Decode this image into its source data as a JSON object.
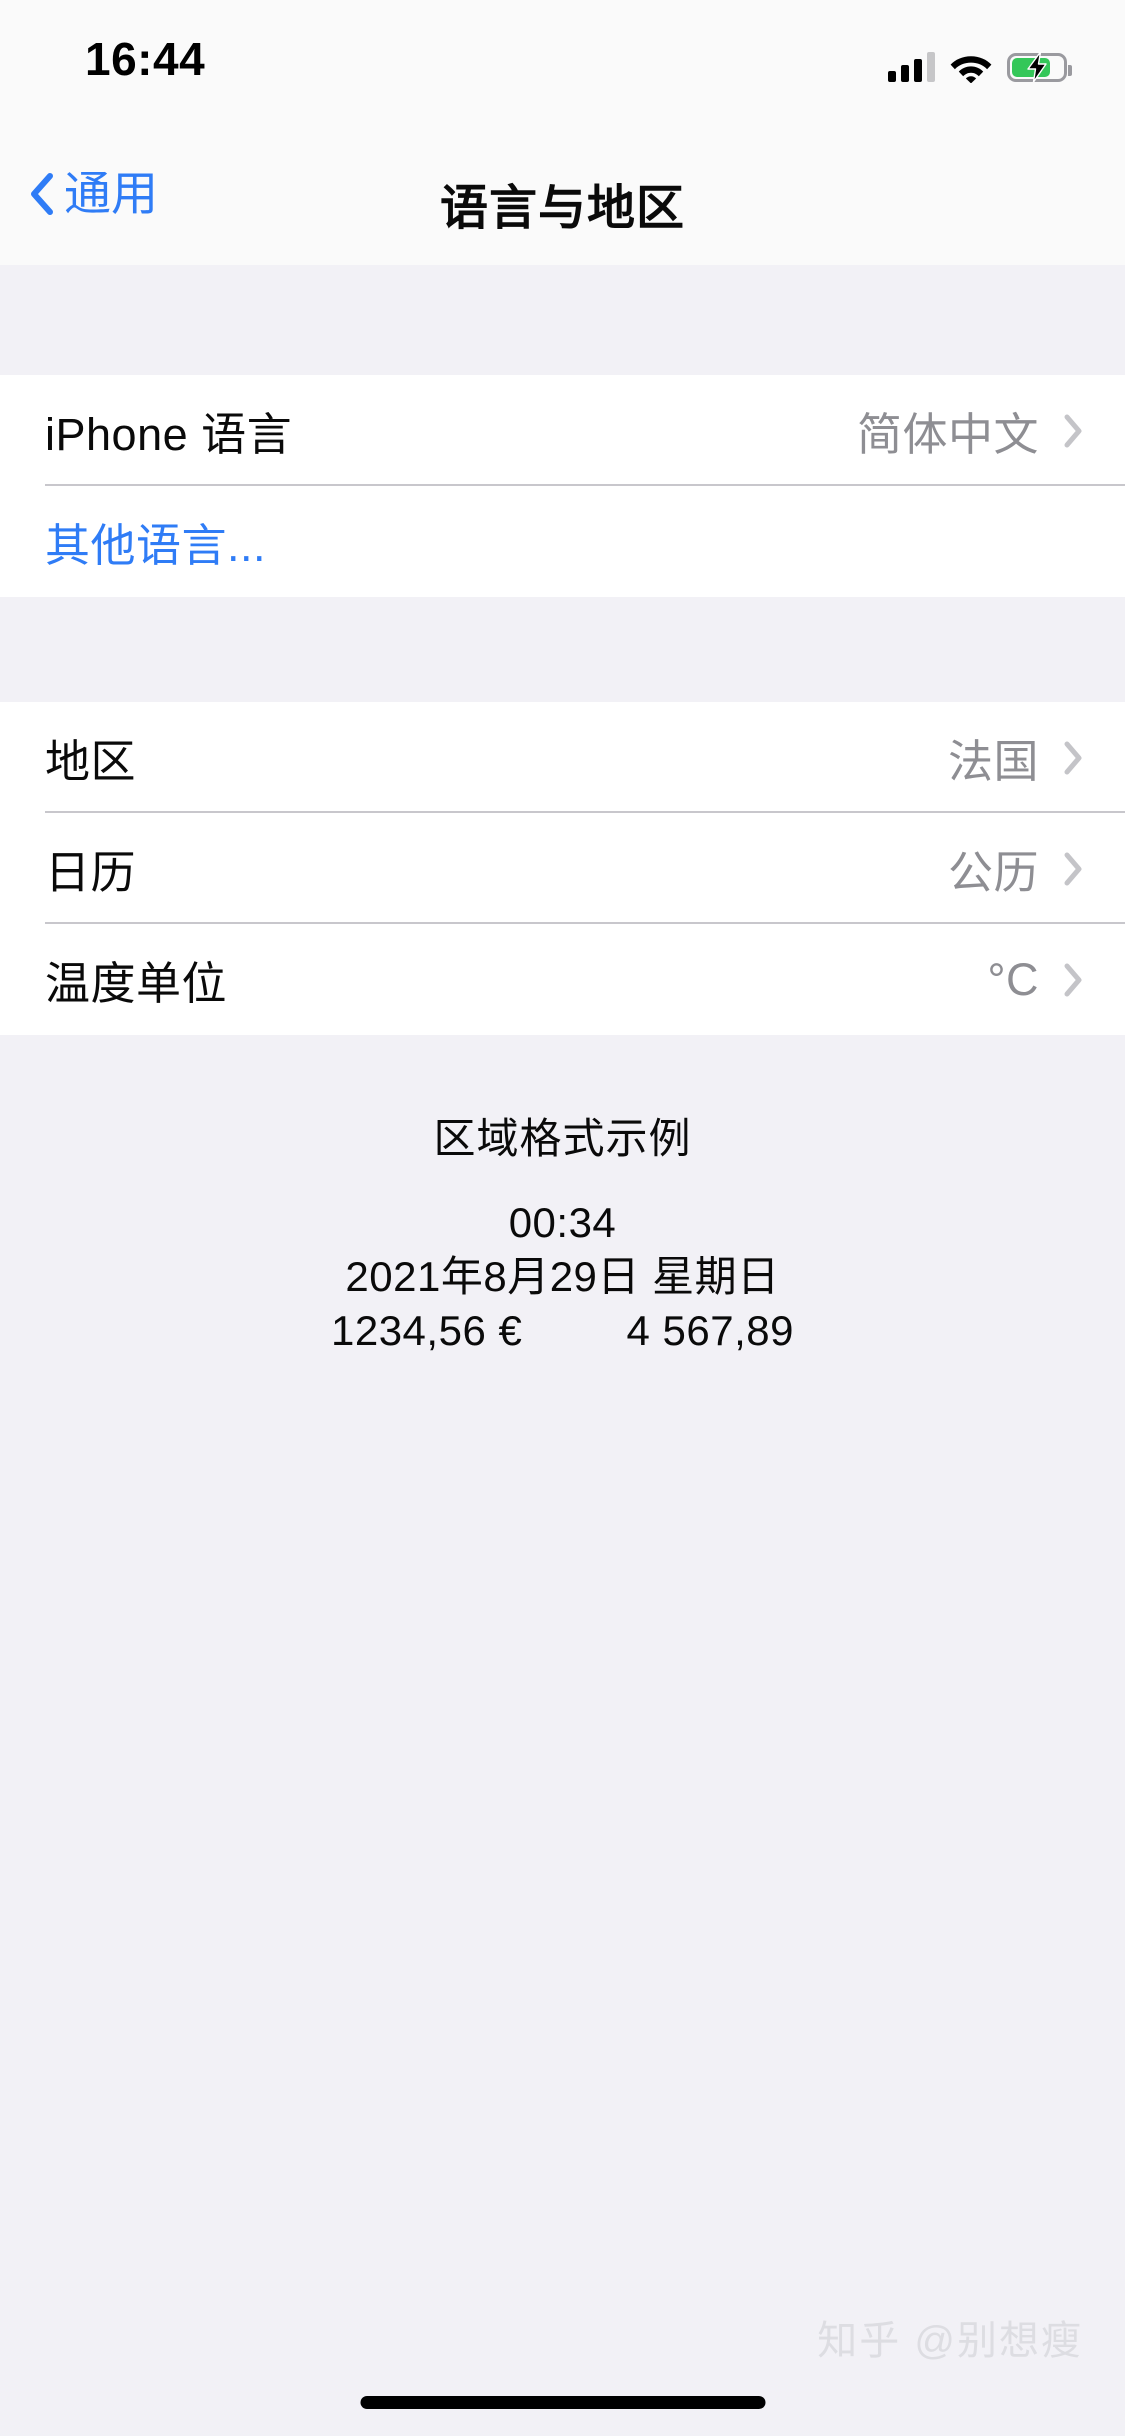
{
  "status_bar": {
    "time": "16:44",
    "icons": {
      "cellular": "signal-bars-icon",
      "wifi": "wifi-icon",
      "battery": "battery-charging-icon"
    },
    "battery_level_percent": 70,
    "signal_bars_filled": 3,
    "signal_bars_total": 4
  },
  "nav": {
    "back_label": "通用",
    "back_icon": "chevron-left-icon",
    "title": "语言与地区"
  },
  "sections": [
    {
      "rows": [
        {
          "label": "iPhone 语言",
          "value": "简体中文",
          "accessory": "chevron-right-icon",
          "style": "default"
        },
        {
          "label": "其他语言...",
          "value": "",
          "accessory": "",
          "style": "link"
        }
      ]
    },
    {
      "rows": [
        {
          "label": "地区",
          "value": "法国",
          "accessory": "chevron-right-icon",
          "style": "default"
        },
        {
          "label": "日历",
          "value": "公历",
          "accessory": "chevron-right-icon",
          "style": "default"
        },
        {
          "label": "温度单位",
          "value": "°C",
          "accessory": "chevron-right-icon",
          "style": "default"
        }
      ]
    }
  ],
  "footer": {
    "title": "区域格式示例",
    "time_sample": "00:34",
    "date_sample": "2021年8月29日 星期日",
    "currency_sample": "1234,56 €",
    "number_sample": "4 567,89"
  },
  "watermark": "知乎 @别想瘦",
  "colors": {
    "accent_blue": "#2f7cf6",
    "group_background": "#f2f1f6",
    "row_background": "#ffffff",
    "secondary_text": "#8e8e93",
    "separator": "#c8c7cc",
    "battery_green": "#34c759"
  }
}
